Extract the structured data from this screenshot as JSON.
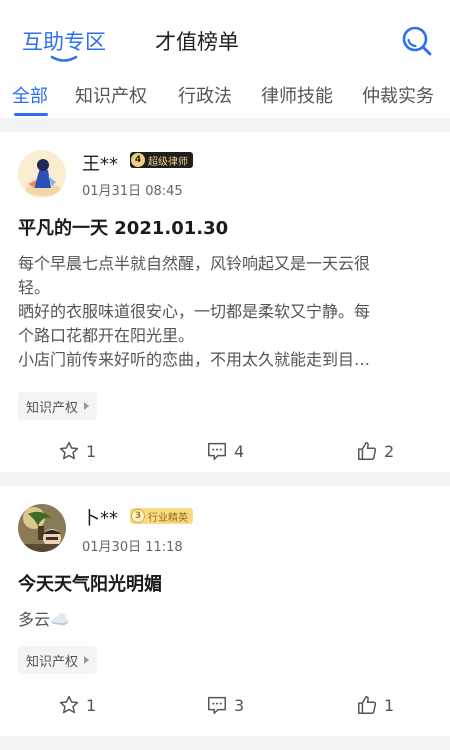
{
  "header": {
    "tabs": [
      {
        "label": "互助专区"
      },
      {
        "label": "才值榜单"
      }
    ]
  },
  "categories": [
    {
      "label": "全部"
    },
    {
      "label": "知识产权"
    },
    {
      "label": "行政法"
    },
    {
      "label": "律师技能"
    },
    {
      "label": "仲裁实务"
    }
  ],
  "posts": [
    {
      "author": "王**",
      "badge_level": "4",
      "badge_text": "超级律师",
      "time": "01月31日 08:45",
      "title": "平凡的一天  2021.01.30",
      "body_lines": [
        "每个早晨七点半就自然醒，风铃响起又是一天云很",
        "轻。",
        "晒好的衣服味道很安心，一切都是柔软又宁静。每",
        "个路口花都开在阳光里。",
        "小店门前传来好听的恋曲，不用太久就能走到目…"
      ],
      "tag": "知识产权",
      "likes": "1",
      "comments": "4",
      "thumbs": "2"
    },
    {
      "author": "卜**",
      "badge_level": "3",
      "badge_text": "行业精英",
      "time": "01月30日 11:18",
      "title": "今天天气阳光明媚",
      "body_lines": [
        "多云☁️"
      ],
      "tag": "知识产权",
      "likes": "1",
      "comments": "3",
      "thumbs": "1"
    }
  ],
  "colors": {
    "accent": "#2b6ff2",
    "divider": "#f2f3f5"
  },
  "icons": [
    "search-icon",
    "star-icon",
    "comment-icon",
    "thumbs-up-icon"
  ]
}
